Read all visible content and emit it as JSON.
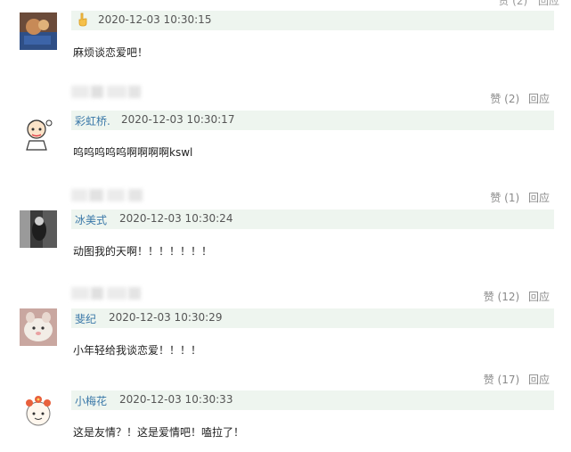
{
  "top_clipped": {
    "like_label": "赞 (2)",
    "reply_label": "回应"
  },
  "comments": [
    {
      "user": "",
      "time": "2020-12-03 10:30:15",
      "text": "麻烦谈恋爱吧！"
    },
    {
      "user": "彩虹桥.",
      "time": "2020-12-03 10:30:17",
      "text": "呜呜呜呜呜啊啊啊啊kswl",
      "like_label": "赞 (2)",
      "reply_label": "回应"
    },
    {
      "user": "冰美式",
      "time": "2020-12-03 10:30:24",
      "text": "动图我的天啊！！！！！！！",
      "like_label": "赞 (1)",
      "reply_label": "回应"
    },
    {
      "user": "斐纪",
      "time": "2020-12-03 10:30:29",
      "text": "小年轻给我谈恋爱！！！！",
      "like_label": "赞 (12)",
      "reply_label": "回应"
    },
    {
      "user": "小梅花",
      "time": "2020-12-03 10:30:33",
      "text": "这是友情？！这是爱情吧！嗑拉了！",
      "like_label": "赞 (17)",
      "reply_label": "回应"
    }
  ],
  "colors": {
    "meta_strip_bg": "#eef5ef",
    "username": "#3a78a8",
    "action_text": "#8a8a8a"
  },
  "icons": {
    "first_meta_icon": "hand-icon"
  }
}
